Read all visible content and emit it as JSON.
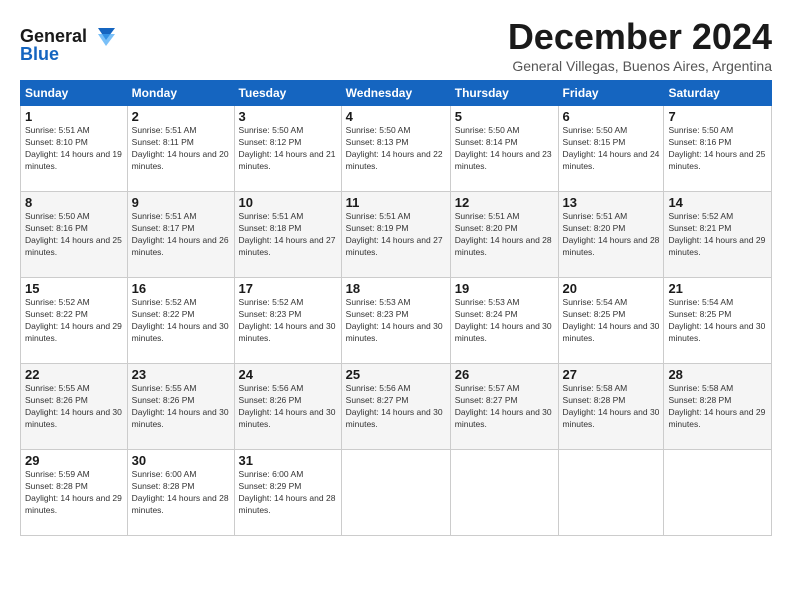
{
  "logo": {
    "line1": "General",
    "line2": "Blue"
  },
  "title": "December 2024",
  "subtitle": "General Villegas, Buenos Aires, Argentina",
  "days_header": [
    "Sunday",
    "Monday",
    "Tuesday",
    "Wednesday",
    "Thursday",
    "Friday",
    "Saturday"
  ],
  "weeks": [
    [
      {
        "day": "1",
        "sunrise": "Sunrise: 5:51 AM",
        "sunset": "Sunset: 8:10 PM",
        "daylight": "Daylight: 14 hours and 19 minutes."
      },
      {
        "day": "2",
        "sunrise": "Sunrise: 5:51 AM",
        "sunset": "Sunset: 8:11 PM",
        "daylight": "Daylight: 14 hours and 20 minutes."
      },
      {
        "day": "3",
        "sunrise": "Sunrise: 5:50 AM",
        "sunset": "Sunset: 8:12 PM",
        "daylight": "Daylight: 14 hours and 21 minutes."
      },
      {
        "day": "4",
        "sunrise": "Sunrise: 5:50 AM",
        "sunset": "Sunset: 8:13 PM",
        "daylight": "Daylight: 14 hours and 22 minutes."
      },
      {
        "day": "5",
        "sunrise": "Sunrise: 5:50 AM",
        "sunset": "Sunset: 8:14 PM",
        "daylight": "Daylight: 14 hours and 23 minutes."
      },
      {
        "day": "6",
        "sunrise": "Sunrise: 5:50 AM",
        "sunset": "Sunset: 8:15 PM",
        "daylight": "Daylight: 14 hours and 24 minutes."
      },
      {
        "day": "7",
        "sunrise": "Sunrise: 5:50 AM",
        "sunset": "Sunset: 8:16 PM",
        "daylight": "Daylight: 14 hours and 25 minutes."
      }
    ],
    [
      {
        "day": "8",
        "sunrise": "Sunrise: 5:50 AM",
        "sunset": "Sunset: 8:16 PM",
        "daylight": "Daylight: 14 hours and 25 minutes."
      },
      {
        "day": "9",
        "sunrise": "Sunrise: 5:51 AM",
        "sunset": "Sunset: 8:17 PM",
        "daylight": "Daylight: 14 hours and 26 minutes."
      },
      {
        "day": "10",
        "sunrise": "Sunrise: 5:51 AM",
        "sunset": "Sunset: 8:18 PM",
        "daylight": "Daylight: 14 hours and 27 minutes."
      },
      {
        "day": "11",
        "sunrise": "Sunrise: 5:51 AM",
        "sunset": "Sunset: 8:19 PM",
        "daylight": "Daylight: 14 hours and 27 minutes."
      },
      {
        "day": "12",
        "sunrise": "Sunrise: 5:51 AM",
        "sunset": "Sunset: 8:20 PM",
        "daylight": "Daylight: 14 hours and 28 minutes."
      },
      {
        "day": "13",
        "sunrise": "Sunrise: 5:51 AM",
        "sunset": "Sunset: 8:20 PM",
        "daylight": "Daylight: 14 hours and 28 minutes."
      },
      {
        "day": "14",
        "sunrise": "Sunrise: 5:52 AM",
        "sunset": "Sunset: 8:21 PM",
        "daylight": "Daylight: 14 hours and 29 minutes."
      }
    ],
    [
      {
        "day": "15",
        "sunrise": "Sunrise: 5:52 AM",
        "sunset": "Sunset: 8:22 PM",
        "daylight": "Daylight: 14 hours and 29 minutes."
      },
      {
        "day": "16",
        "sunrise": "Sunrise: 5:52 AM",
        "sunset": "Sunset: 8:22 PM",
        "daylight": "Daylight: 14 hours and 30 minutes."
      },
      {
        "day": "17",
        "sunrise": "Sunrise: 5:52 AM",
        "sunset": "Sunset: 8:23 PM",
        "daylight": "Daylight: 14 hours and 30 minutes."
      },
      {
        "day": "18",
        "sunrise": "Sunrise: 5:53 AM",
        "sunset": "Sunset: 8:23 PM",
        "daylight": "Daylight: 14 hours and 30 minutes."
      },
      {
        "day": "19",
        "sunrise": "Sunrise: 5:53 AM",
        "sunset": "Sunset: 8:24 PM",
        "daylight": "Daylight: 14 hours and 30 minutes."
      },
      {
        "day": "20",
        "sunrise": "Sunrise: 5:54 AM",
        "sunset": "Sunset: 8:25 PM",
        "daylight": "Daylight: 14 hours and 30 minutes."
      },
      {
        "day": "21",
        "sunrise": "Sunrise: 5:54 AM",
        "sunset": "Sunset: 8:25 PM",
        "daylight": "Daylight: 14 hours and 30 minutes."
      }
    ],
    [
      {
        "day": "22",
        "sunrise": "Sunrise: 5:55 AM",
        "sunset": "Sunset: 8:26 PM",
        "daylight": "Daylight: 14 hours and 30 minutes."
      },
      {
        "day": "23",
        "sunrise": "Sunrise: 5:55 AM",
        "sunset": "Sunset: 8:26 PM",
        "daylight": "Daylight: 14 hours and 30 minutes."
      },
      {
        "day": "24",
        "sunrise": "Sunrise: 5:56 AM",
        "sunset": "Sunset: 8:26 PM",
        "daylight": "Daylight: 14 hours and 30 minutes."
      },
      {
        "day": "25",
        "sunrise": "Sunrise: 5:56 AM",
        "sunset": "Sunset: 8:27 PM",
        "daylight": "Daylight: 14 hours and 30 minutes."
      },
      {
        "day": "26",
        "sunrise": "Sunrise: 5:57 AM",
        "sunset": "Sunset: 8:27 PM",
        "daylight": "Daylight: 14 hours and 30 minutes."
      },
      {
        "day": "27",
        "sunrise": "Sunrise: 5:58 AM",
        "sunset": "Sunset: 8:28 PM",
        "daylight": "Daylight: 14 hours and 30 minutes."
      },
      {
        "day": "28",
        "sunrise": "Sunrise: 5:58 AM",
        "sunset": "Sunset: 8:28 PM",
        "daylight": "Daylight: 14 hours and 29 minutes."
      }
    ],
    [
      {
        "day": "29",
        "sunrise": "Sunrise: 5:59 AM",
        "sunset": "Sunset: 8:28 PM",
        "daylight": "Daylight: 14 hours and 29 minutes."
      },
      {
        "day": "30",
        "sunrise": "Sunrise: 6:00 AM",
        "sunset": "Sunset: 8:28 PM",
        "daylight": "Daylight: 14 hours and 28 minutes."
      },
      {
        "day": "31",
        "sunrise": "Sunrise: 6:00 AM",
        "sunset": "Sunset: 8:29 PM",
        "daylight": "Daylight: 14 hours and 28 minutes."
      },
      null,
      null,
      null,
      null
    ]
  ]
}
